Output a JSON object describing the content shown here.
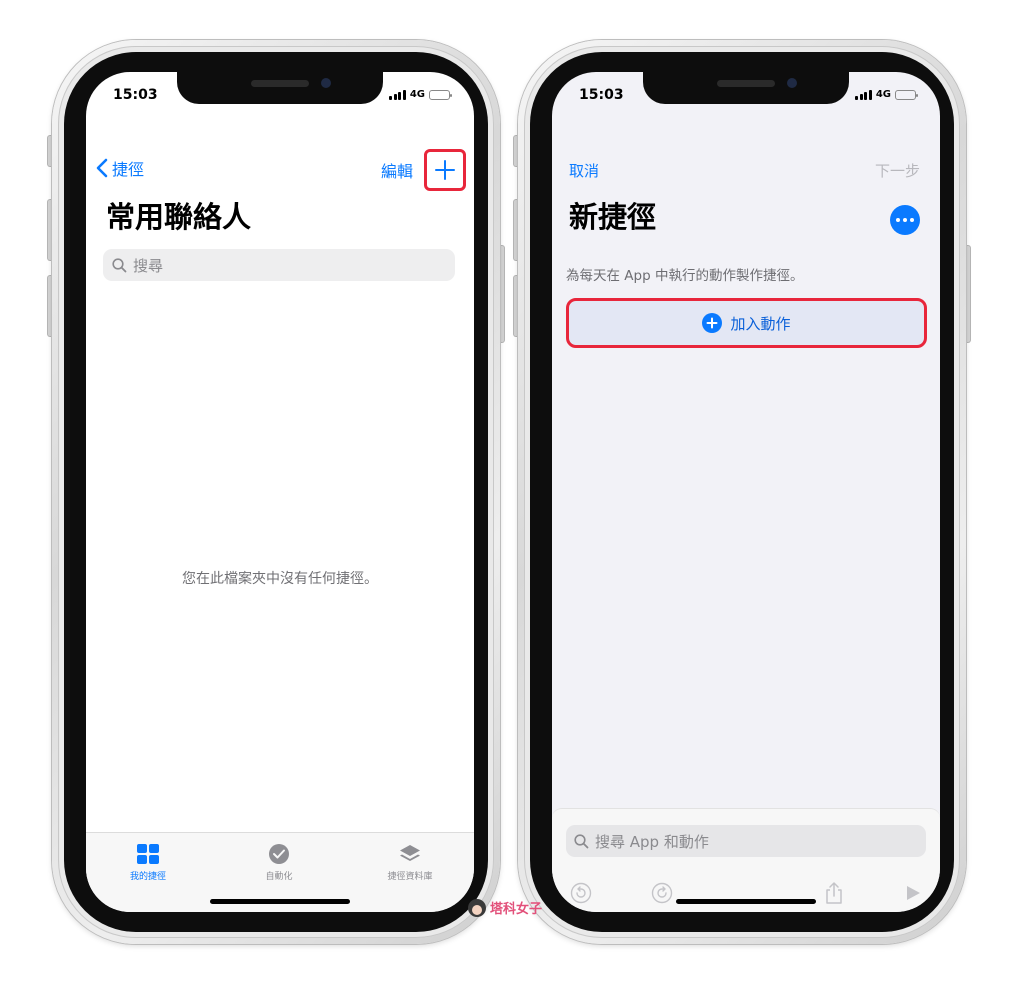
{
  "left_phone": {
    "status": {
      "time": "15:03",
      "network": "4G"
    },
    "nav": {
      "back_label": "捷徑",
      "edit_label": "編輯"
    },
    "title": "常用聯絡人",
    "search": {
      "placeholder": "搜尋"
    },
    "empty_message": "您在此檔案夾中沒有任何捷徑。",
    "tabs": [
      {
        "label": "我的捷徑",
        "icon": "grid-icon",
        "active": true
      },
      {
        "label": "自動化",
        "icon": "automation-clock-icon",
        "active": false
      },
      {
        "label": "捷徑資料庫",
        "icon": "layers-icon",
        "active": false
      }
    ]
  },
  "right_phone": {
    "status": {
      "time": "15:03",
      "network": "4G"
    },
    "nav": {
      "cancel_label": "取消",
      "next_label": "下一步"
    },
    "title": "新捷徑",
    "description": "為每天在 App 中執行的動作製作捷徑。",
    "add_action_label": "加入動作",
    "search": {
      "placeholder": "搜尋 App 和動作"
    },
    "toolbar_icons": [
      "undo-icon",
      "redo-icon",
      "share-icon",
      "play-icon"
    ]
  },
  "watermark": {
    "text": "塔科女子"
  },
  "colors": {
    "accent": "#0a7aff",
    "highlight": "#e8263b",
    "watermark": "#e2507a"
  }
}
